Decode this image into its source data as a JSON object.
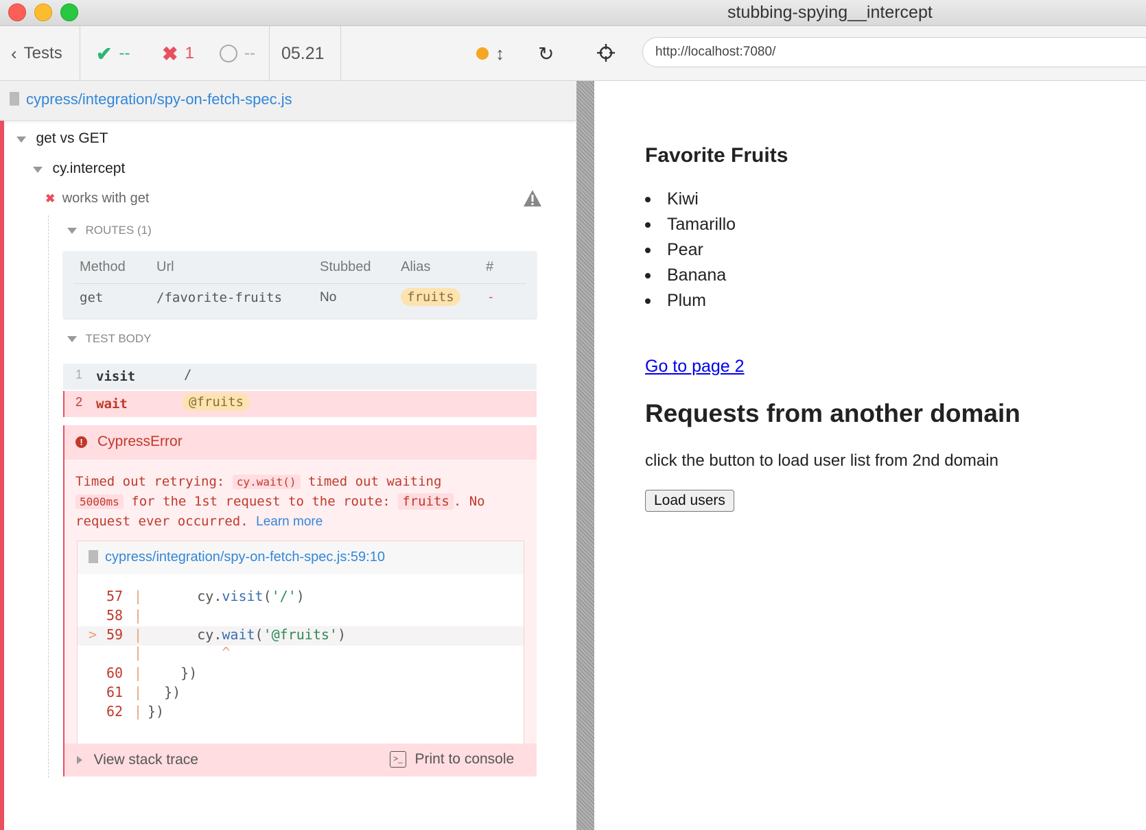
{
  "window": {
    "title": "stubbing-spying__intercept"
  },
  "reporter": {
    "back_label": "Tests",
    "stats": {
      "passed": "--",
      "failed": "1",
      "pending": "--",
      "duration": "05.21"
    },
    "spec_path": "cypress/integration/spy-on-fetch-spec.js",
    "suite": "get vs GET",
    "sub_suite": "cy.intercept",
    "test_title": "works with get",
    "routes": {
      "header": "ROUTES (1)",
      "columns": [
        "Method",
        "Url",
        "Stubbed",
        "Alias",
        "#"
      ],
      "rows": [
        {
          "method": "get",
          "url": "/favorite-fruits",
          "stubbed": "No",
          "alias": "fruits",
          "count": "-"
        }
      ]
    },
    "test_body": {
      "header": "TEST BODY",
      "commands": [
        {
          "num": "1",
          "name": "visit",
          "message": "/"
        },
        {
          "num": "2",
          "name": "wait",
          "message": "@fruits"
        }
      ]
    },
    "error": {
      "name": "CypressError",
      "msg_1": "Timed out retrying:",
      "code_1": "cy.wait()",
      "msg_2": "timed out waiting",
      "code_2": "5000ms",
      "msg_3": "for the 1st request to the route:",
      "code_3": "fruits",
      "msg_4": ". No",
      "msg_5": "request ever occurred.",
      "learn_more": "Learn more",
      "file": "cypress/integration/spy-on-fetch-spec.js:59:10",
      "code_lines": [
        {
          "marker": "",
          "num": "57",
          "pre": "      cy.",
          "fn": "visit",
          "arg": "'/'",
          "post": ")"
        },
        {
          "marker": "",
          "num": "58",
          "pre": "",
          "fn": "",
          "arg": "",
          "post": ""
        },
        {
          "marker": ">",
          "num": "59",
          "pre": "      cy.",
          "fn": "wait",
          "arg": "'@fruits'",
          "post": ")"
        },
        {
          "marker": "",
          "num": "",
          "pre": "         ^",
          "fn": "",
          "arg": "",
          "post": ""
        },
        {
          "marker": "",
          "num": "60",
          "pre": "    })",
          "fn": "",
          "arg": "",
          "post": ""
        },
        {
          "marker": "",
          "num": "61",
          "pre": "  })",
          "fn": "",
          "arg": "",
          "post": ""
        },
        {
          "marker": "",
          "num": "62",
          "pre": "})",
          "fn": "",
          "arg": "",
          "post": ""
        }
      ],
      "stack_trace_label": "View stack trace",
      "print_label": "Print to console"
    }
  },
  "browser": {
    "url": "http://localhost:7080/"
  },
  "app": {
    "heading": "Favorite Fruits",
    "fruits": [
      "Kiwi",
      "Tamarillo",
      "Pear",
      "Banana",
      "Plum"
    ],
    "link": "Go to page 2",
    "heading2": "Requests from another domain",
    "paragraph": "click the button to load user list from 2nd domain",
    "button": "Load users"
  },
  "colors": {
    "pass": "#2bb673",
    "fail": "#e94f5f",
    "link": "#3386d8",
    "pending_dot": "#f6a623"
  }
}
